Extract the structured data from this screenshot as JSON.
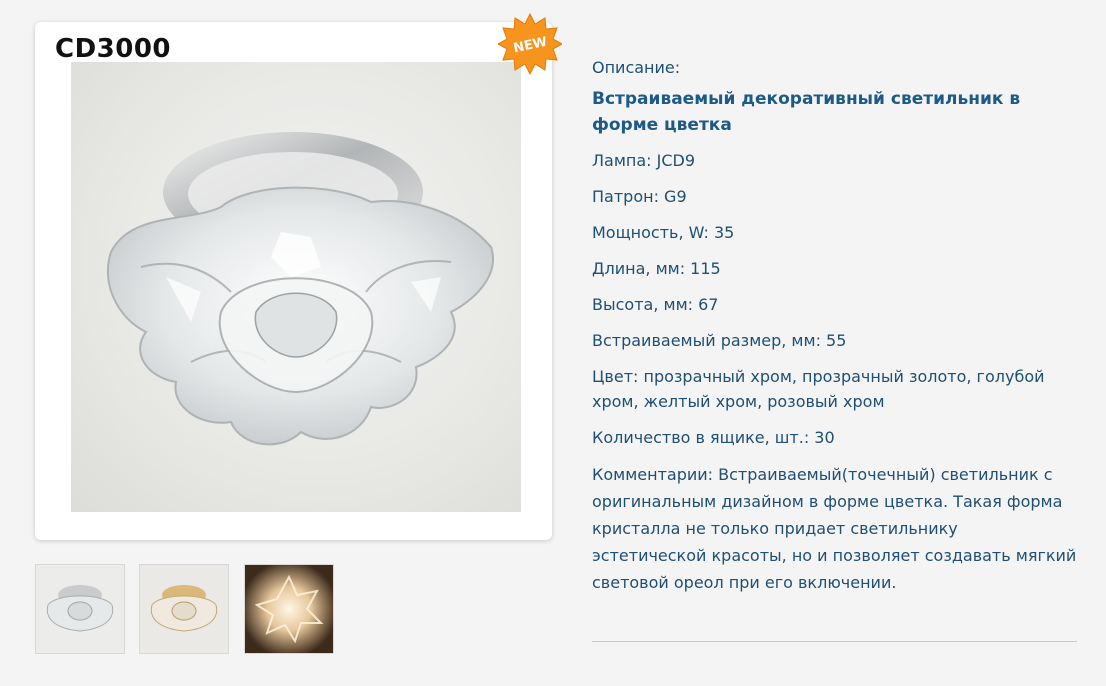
{
  "product": {
    "title": "CD3000",
    "badge": "NEW"
  },
  "colors": {
    "accent_text": "#1f4f73",
    "badge": "#f7941d",
    "background": "#f4f4f4"
  },
  "thumbnails": [
    {
      "name": "thumb-clear-view"
    },
    {
      "name": "thumb-gold-view"
    },
    {
      "name": "thumb-lit-view"
    }
  ],
  "details": {
    "description_label": "Описание:",
    "headline": "Встраиваемый декоративный светильник в форме цветка",
    "lamp": "Лампа: JCD9",
    "socket": "Патрон: G9",
    "power": "Мощность, W: 35",
    "length": "Длина, мм: 115",
    "height": "Высота, мм: 67",
    "cutout": "Встраиваемый размер, мм: 55",
    "color": "Цвет: прозрачный хром, прозрачный золото, голубой хром, желтый хром, розовый хром",
    "quantity": "Количество в ящике, шт.: 30",
    "comment": "Комментарии: Встраиваемый(точечный) светильник с оригинальным дизайном в форме цветка. Такая форма кристалла не только придает светильнику эстетической красоты, но и позволяет создавать мягкий световой ореол при его включении."
  }
}
